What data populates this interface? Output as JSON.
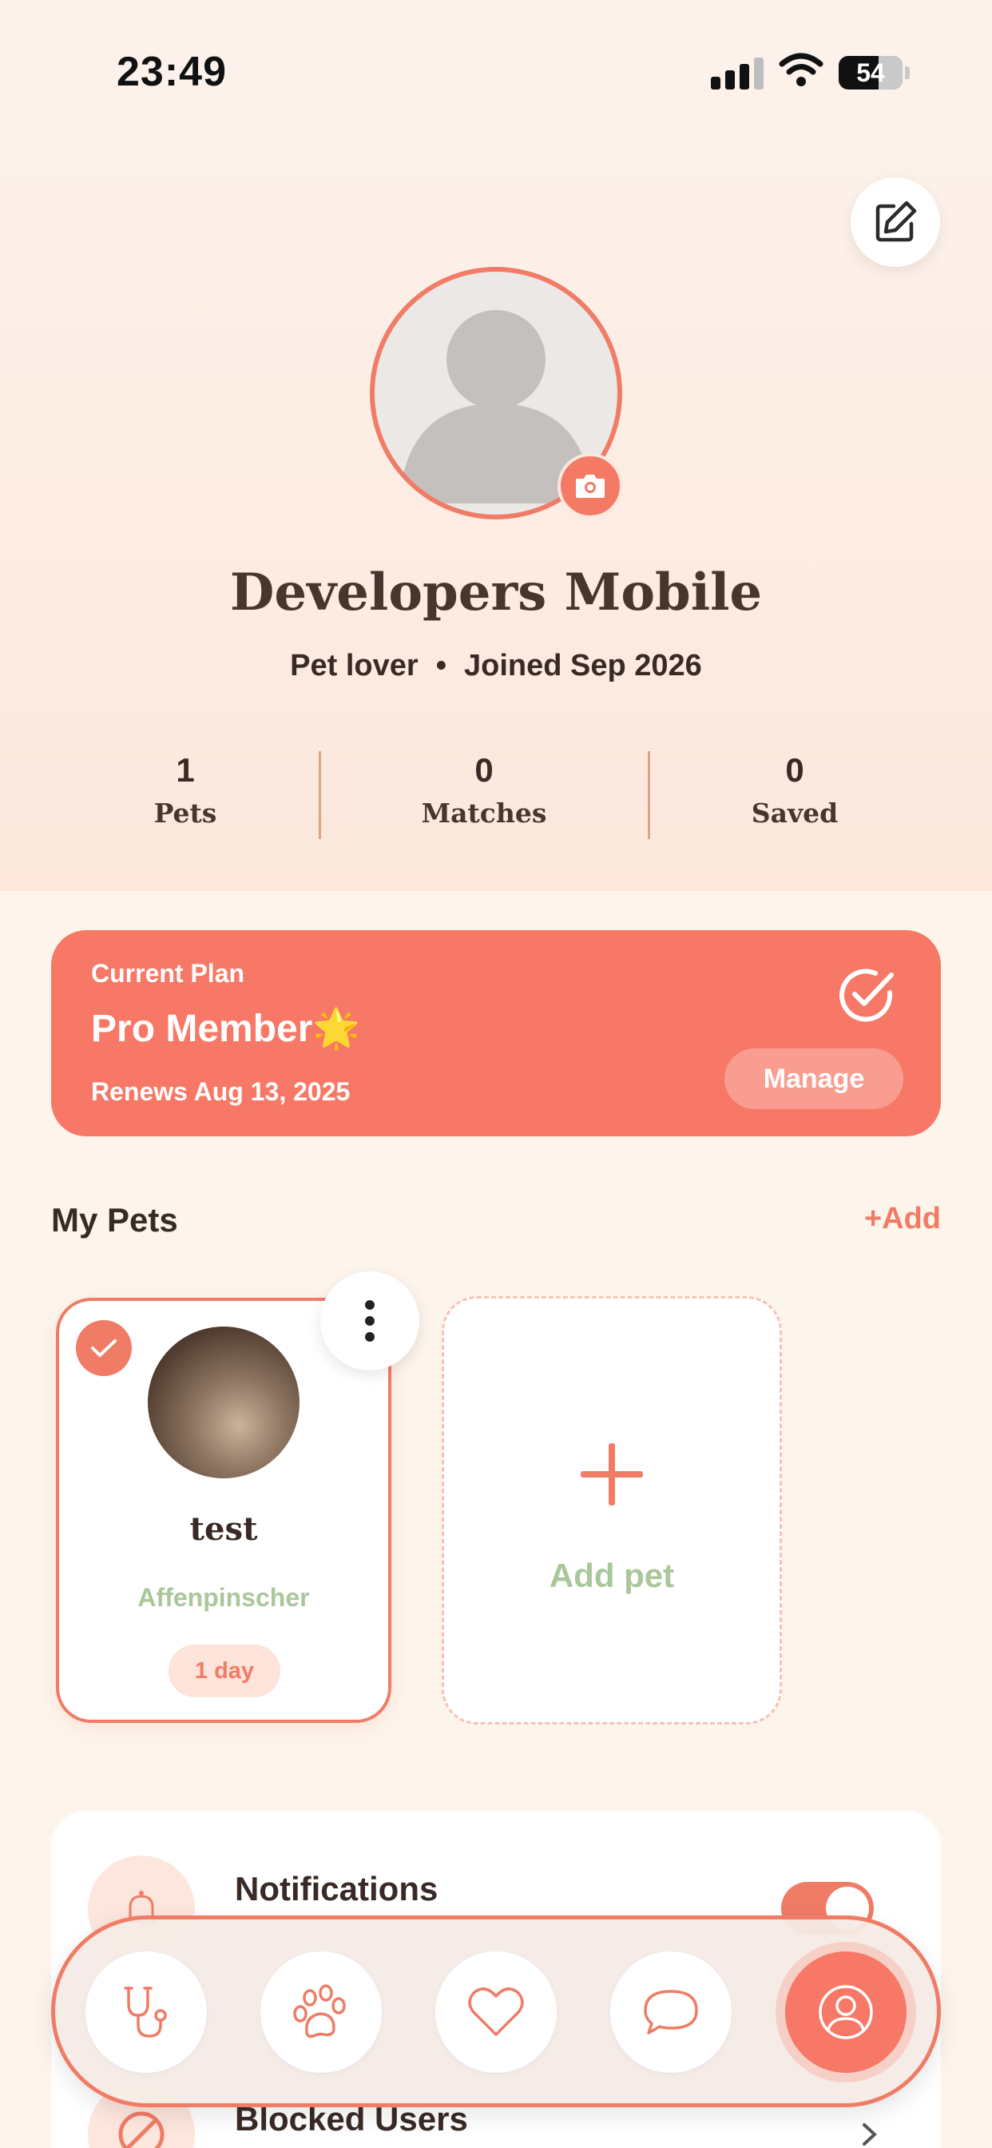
{
  "status_bar": {
    "time": "23:49",
    "battery": "54",
    "icons": [
      "signal-icon",
      "wifi-icon",
      "battery-icon"
    ]
  },
  "profile": {
    "name": "Developers Mobile",
    "tagline": "Pet lover",
    "separator": "•",
    "joined": "Joined Sep 2026",
    "stats": [
      {
        "value": "1",
        "label": "Pets"
      },
      {
        "value": "0",
        "label": "Matches"
      },
      {
        "value": "0",
        "label": "Saved"
      }
    ]
  },
  "plan": {
    "heading": "Current Plan",
    "name": "Pro Member",
    "badge": "🌟",
    "renews": "Renews Aug 13, 2025",
    "manage_label": "Manage"
  },
  "pets_section": {
    "title": "My Pets",
    "add_label": "+Add",
    "pets": [
      {
        "name": "test",
        "breed": "Affenpinscher",
        "age": "1 day",
        "selected": true
      }
    ],
    "add_pet_label": "Add pet"
  },
  "settings": {
    "items": [
      {
        "label": "Notifications",
        "icon": "bell-icon",
        "toggle_on": true
      },
      {
        "label": "Blocked Users",
        "icon": "block-icon"
      }
    ]
  },
  "bottom_nav": {
    "items": [
      {
        "icon": "stethoscope-icon",
        "active": false
      },
      {
        "icon": "paw-icon",
        "active": false
      },
      {
        "icon": "heart-icon",
        "active": false
      },
      {
        "icon": "chat-icon",
        "active": false
      },
      {
        "icon": "profile-icon",
        "active": true
      }
    ]
  },
  "colors": {
    "accent": "#f07c66",
    "plan_bg": "#f77866",
    "breed_green": "#a9c79b",
    "background": "#fdf4ec"
  }
}
